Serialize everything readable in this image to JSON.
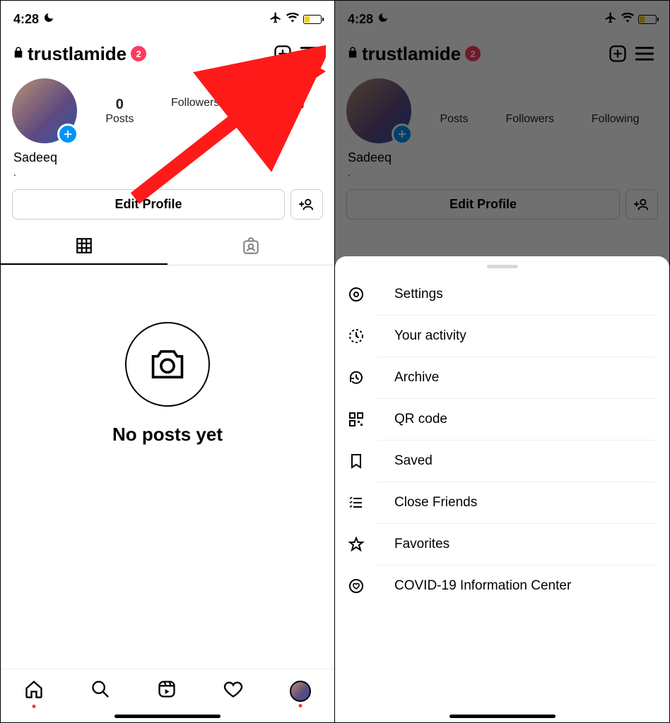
{
  "status": {
    "time": "4:28"
  },
  "header": {
    "username": "trustlamide",
    "badge_count": "2"
  },
  "stats": {
    "posts": {
      "count": "0",
      "label": "Posts"
    },
    "followers": {
      "label": "Followers"
    },
    "following": {
      "label": "Following"
    }
  },
  "profile": {
    "display_name": "Sadeeq",
    "bio": "."
  },
  "actions": {
    "edit_label": "Edit Profile"
  },
  "empty": {
    "text": "No posts yet"
  },
  "menu": {
    "items": [
      {
        "label": "Settings"
      },
      {
        "label": "Your activity"
      },
      {
        "label": "Archive"
      },
      {
        "label": "QR code"
      },
      {
        "label": "Saved"
      },
      {
        "label": "Close Friends"
      },
      {
        "label": "Favorites"
      },
      {
        "label": "COVID-19 Information Center"
      }
    ]
  },
  "colors": {
    "accent": "#0095f6",
    "badge": "#ff3b5c",
    "battery_low": "#ffcc00"
  }
}
